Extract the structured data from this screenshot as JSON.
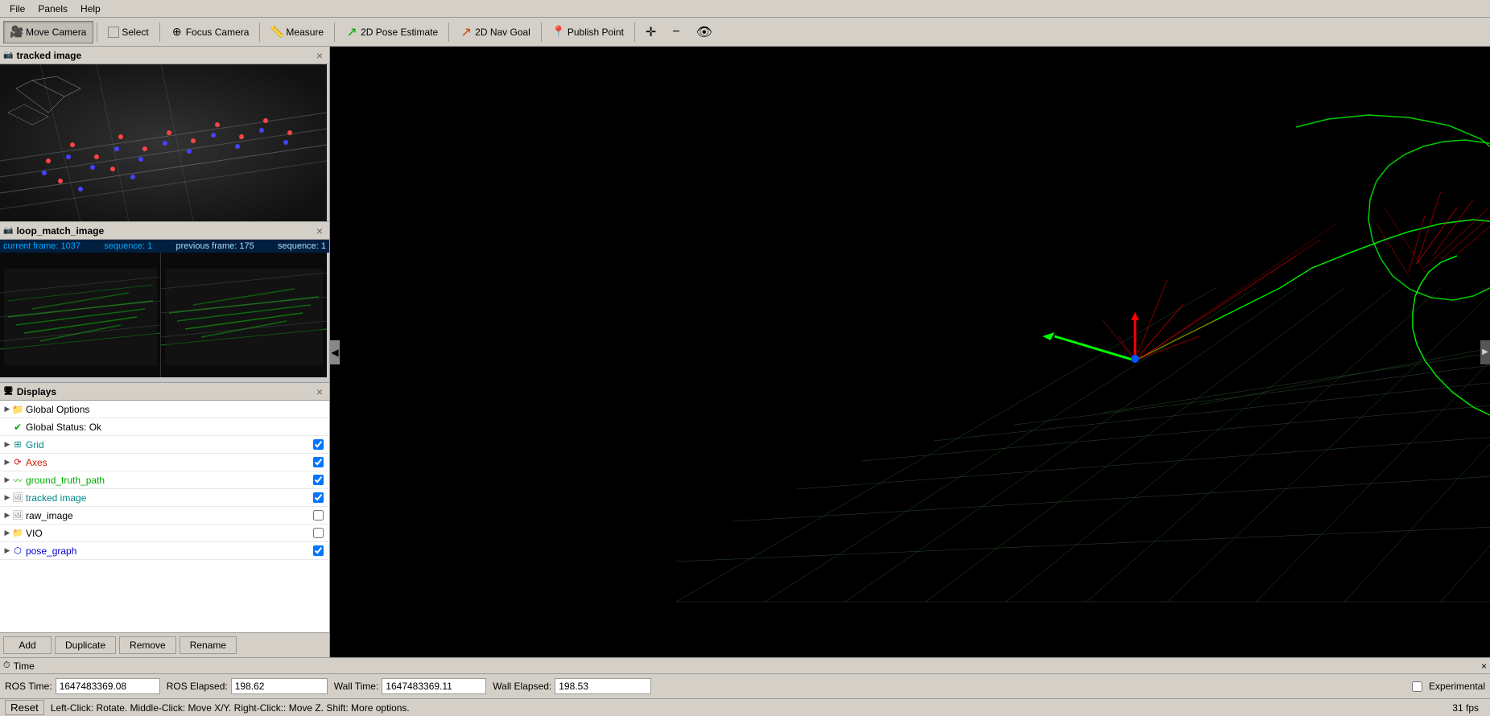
{
  "menubar": {
    "items": [
      "File",
      "Panels",
      "Help"
    ]
  },
  "toolbar": {
    "move_camera": "Move Camera",
    "select": "Select",
    "focus_camera": "Focus Camera",
    "measure": "Measure",
    "pose_estimate": "2D Pose Estimate",
    "nav_goal": "2D Nav Goal",
    "publish_point": "Publish Point"
  },
  "panels": {
    "tracked_image": {
      "title": "tracked image",
      "close": "×"
    },
    "loop_match": {
      "title": "loop_match_image",
      "close": "×",
      "info": {
        "current_frame": "current frame: 1037",
        "sequence": "sequence: 1",
        "previous_frame": "previous frame: 175",
        "prev_sequence": "sequence: 1"
      }
    }
  },
  "displays": {
    "title": "Displays",
    "close": "×",
    "items": [
      {
        "indent": 0,
        "expandable": true,
        "icon": "folder",
        "name": "Global Options",
        "checked": null,
        "color": ""
      },
      {
        "indent": 0,
        "expandable": false,
        "icon": "check-green",
        "name": "Global Status: Ok",
        "checked": null,
        "color": "green"
      },
      {
        "indent": 0,
        "expandable": true,
        "icon": "grid",
        "name": "Grid",
        "checked": true,
        "color": "teal"
      },
      {
        "indent": 0,
        "expandable": true,
        "icon": "axes",
        "name": "Axes",
        "checked": true,
        "color": "red"
      },
      {
        "indent": 0,
        "expandable": true,
        "icon": "path",
        "name": "ground_truth_path",
        "checked": true,
        "color": "green"
      },
      {
        "indent": 0,
        "expandable": true,
        "icon": "image",
        "name": "tracked image",
        "checked": true,
        "color": "gray"
      },
      {
        "indent": 0,
        "expandable": true,
        "icon": "image",
        "name": "raw_image",
        "checked": false,
        "color": "gray"
      },
      {
        "indent": 0,
        "expandable": true,
        "icon": "folder",
        "name": "VIO",
        "checked": false,
        "color": "gray"
      },
      {
        "indent": 0,
        "expandable": true,
        "icon": "graph",
        "name": "pose_graph",
        "checked": true,
        "color": "blue"
      }
    ],
    "buttons": {
      "add": "Add",
      "duplicate": "Duplicate",
      "remove": "Remove",
      "rename": "Rename"
    }
  },
  "time_panel": {
    "title": "Time",
    "close": "×",
    "ros_time_label": "ROS Time:",
    "ros_time_value": "1647483369.08",
    "ros_elapsed_label": "ROS Elapsed:",
    "ros_elapsed_value": "198.62",
    "wall_time_label": "Wall Time:",
    "wall_time_value": "1647483369.11",
    "wall_elapsed_label": "Wall Elapsed:",
    "wall_elapsed_value": "198.53",
    "experimental_label": "Experimental"
  },
  "status_bar": {
    "reset": "Reset",
    "help_text": "Left-Click: Rotate. Middle-Click: Move X/Y. Right-Click:: Move Z. Shift: More options.",
    "fps": "31 fps"
  },
  "viewport": {
    "accent_color": "#00ff00",
    "grid_color": "#3a5a3a"
  }
}
